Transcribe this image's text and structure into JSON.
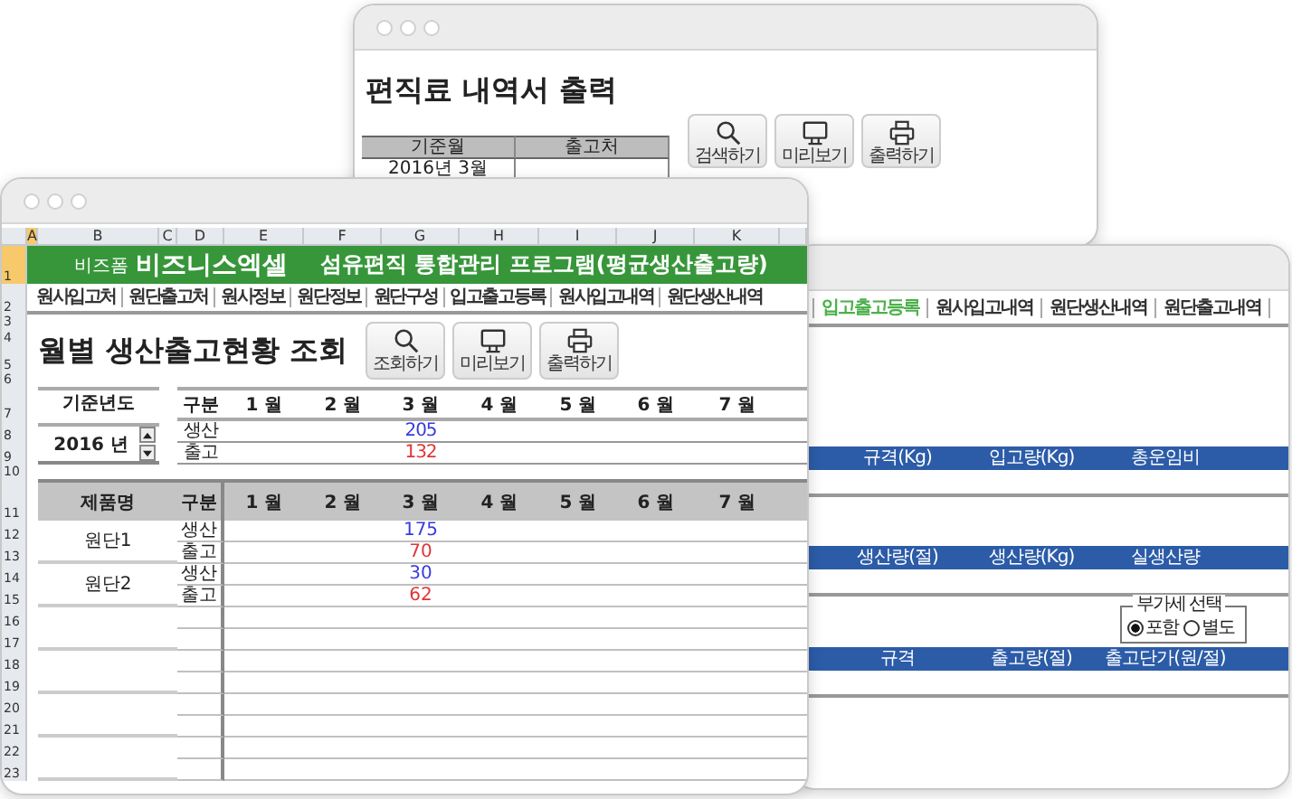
{
  "report_window": {
    "title": "편직료 내역서 출력",
    "table": {
      "columns": [
        "기준월",
        "출고처"
      ],
      "rows": [
        [
          "2016년 3월"
        ]
      ]
    },
    "buttons": [
      {
        "label": "검색하기",
        "kind": "search"
      },
      {
        "label": "미리보기",
        "kind": "preview"
      },
      {
        "label": "출력하기",
        "kind": "print"
      }
    ]
  },
  "sheet": {
    "column_headers": [
      {
        "label": "A",
        "selected": true
      },
      {
        "label": "B",
        "selected": false
      },
      {
        "label": "C",
        "selected": false
      },
      {
        "label": "D",
        "selected": false
      },
      {
        "label": "E",
        "selected": false
      },
      {
        "label": "F",
        "selected": false
      },
      {
        "label": "G",
        "selected": false
      },
      {
        "label": "H",
        "selected": false
      },
      {
        "label": "I",
        "selected": false
      },
      {
        "label": "J",
        "selected": false
      },
      {
        "label": "K",
        "selected": false
      }
    ],
    "row_numbers": [
      {
        "label": "1",
        "selected": true
      },
      {
        "label": "2",
        "selected": false
      },
      {
        "label": "3",
        "selected": false
      },
      {
        "label": "4",
        "selected": false
      },
      {
        "label": "5",
        "selected": false
      },
      {
        "label": "6",
        "selected": false
      },
      {
        "label": "7",
        "selected": false
      },
      {
        "label": "8",
        "selected": false
      },
      {
        "label": "9",
        "selected": false
      },
      {
        "label": "10",
        "selected": false
      },
      {
        "label": "11",
        "selected": false
      },
      {
        "label": "12",
        "selected": false
      },
      {
        "label": "13",
        "selected": false
      },
      {
        "label": "14",
        "selected": false
      },
      {
        "label": "15",
        "selected": false
      },
      {
        "label": "16",
        "selected": false
      },
      {
        "label": "17",
        "selected": false
      },
      {
        "label": "18",
        "selected": false
      },
      {
        "label": "19",
        "selected": false
      },
      {
        "label": "20",
        "selected": false
      },
      {
        "label": "21",
        "selected": false
      },
      {
        "label": "22",
        "selected": false
      },
      {
        "label": "23",
        "selected": false
      }
    ],
    "banner": {
      "brand_small": "비즈폼",
      "brand": "비즈니스엑셀",
      "title": "섬유편직 통합관리 프로그램(평균생산출고량)"
    },
    "nav": [
      {
        "label": "원사입고처",
        "selected": false
      },
      {
        "label": "원단출고처",
        "selected": false
      },
      {
        "label": "원사정보",
        "selected": false
      },
      {
        "label": "원단정보",
        "selected": false
      },
      {
        "label": "원단구성",
        "selected": false
      },
      {
        "label": "입고출고등록",
        "selected": false
      },
      {
        "label": "원사입고내역",
        "selected": false
      },
      {
        "label": "원단생산내역",
        "selected": false
      }
    ],
    "title": "월별 생산출고현황 조회",
    "buttons": [
      {
        "label": "조회하기",
        "kind": "search"
      },
      {
        "label": "미리보기",
        "kind": "preview"
      },
      {
        "label": "출력하기",
        "kind": "print"
      }
    ],
    "year_filter": {
      "label": "기준년도",
      "value": "2016 년"
    },
    "summary": {
      "label_column": "구분",
      "rows": [
        {
          "label": "생산",
          "kind": "production"
        },
        {
          "label": "출고",
          "kind": "shipment"
        }
      ],
      "months": [
        {
          "label": "1 월"
        },
        {
          "label": "2 월"
        },
        {
          "label": "3 월",
          "values": {
            "production": "205",
            "shipment": "132"
          }
        },
        {
          "label": "4 월"
        },
        {
          "label": "5 월"
        },
        {
          "label": "6 월"
        },
        {
          "label": "7 월"
        }
      ]
    },
    "products": {
      "name_column": "제품명",
      "label_column": "구분",
      "items": [
        {
          "name": "원단1",
          "rows": [
            {
              "label": "생산",
              "kind": "production"
            },
            {
              "label": "출고",
              "kind": "shipment"
            }
          ]
        },
        {
          "name": "원단2",
          "rows": [
            {
              "label": "생산",
              "kind": "production"
            },
            {
              "label": "출고",
              "kind": "shipment"
            }
          ]
        }
      ],
      "months": [
        {
          "label": "1 월"
        },
        {
          "label": "2 월"
        },
        {
          "label": "3 월",
          "values": [
            {
              "production": "175",
              "shipment": "70"
            },
            {
              "production": "30",
              "shipment": "62"
            }
          ]
        },
        {
          "label": "4 월"
        },
        {
          "label": "5 월"
        },
        {
          "label": "6 월"
        },
        {
          "label": "7 월"
        }
      ]
    }
  },
  "register_window": {
    "nav": [
      {
        "label": "입고출고등록",
        "selected": true
      },
      {
        "label": "원사입고내역",
        "selected": false
      },
      {
        "label": "원단생산내역",
        "selected": false
      },
      {
        "label": "원단출고내역",
        "selected": false
      }
    ],
    "sections": [
      {
        "columns": [
          "규격(Kg)",
          "입고량(Kg)",
          "총운임비"
        ]
      },
      {
        "columns": [
          "생산량(절)",
          "생산량(Kg)",
          "실생산량"
        ]
      },
      {
        "vat_option": {
          "legend": "부가세 선택",
          "options": [
            {
              "label": "포함",
              "selected": true
            },
            {
              "label": "별도",
              "selected": false
            }
          ]
        },
        "columns": [
          "규격",
          "출고량(절)",
          "출고단가(원/절)"
        ]
      }
    ]
  }
}
